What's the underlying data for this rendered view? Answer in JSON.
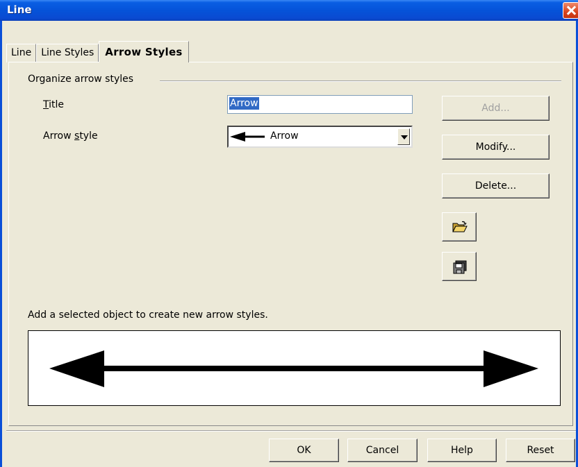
{
  "window": {
    "title": "Line"
  },
  "tabs": [
    {
      "label": "Line",
      "active": false
    },
    {
      "label": "Line Styles",
      "active": false
    },
    {
      "label": "Arrow Styles",
      "active": true
    }
  ],
  "group": {
    "title": "Organize arrow styles"
  },
  "fields": {
    "title_label": "Title",
    "title_value": "Arrow",
    "arrow_style_label": "Arrow style",
    "arrow_style_value": "Arrow"
  },
  "buttons": {
    "add": "Add...",
    "modify": "Modify...",
    "delete": "Delete...",
    "open_icon": "folder-open-icon",
    "save_icon": "floppy-save-icon"
  },
  "hint": "Add a selected object to create new arrow styles.",
  "dialog_buttons": {
    "ok": "OK",
    "cancel": "Cancel",
    "help": "Help",
    "reset": "Reset"
  },
  "colors": {
    "titlebar": "#0553d9",
    "selection": "#316ac5",
    "dialog_bg": "#ece9d8"
  }
}
